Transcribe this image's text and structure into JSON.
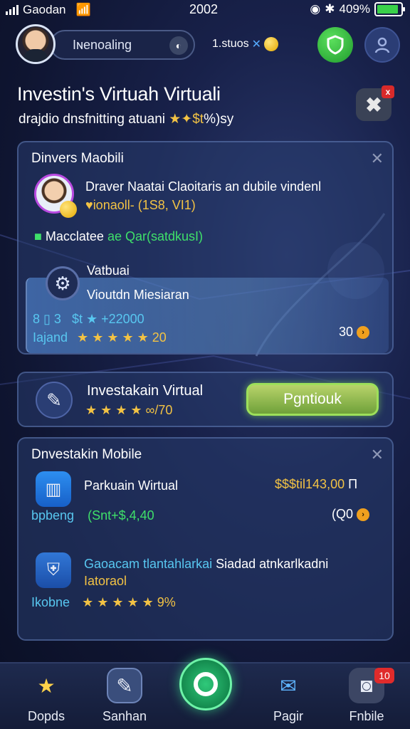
{
  "status_bar": {
    "carrier": "Gaodan",
    "time": "2002",
    "battery_text": "409%",
    "battery_level": 0.9
  },
  "header": {
    "search_text": "Iɴenoaling",
    "status_label": "1.stuos",
    "status_suffix": "✕"
  },
  "page": {
    "title": "Investin's Virtuah Virtuali",
    "subtitle_prefix": "drajdio dnsfnitting atuani",
    "subtitle_stars": "★✦$t",
    "subtitle_suffix": "%)sy",
    "close_badge": "x"
  },
  "card1": {
    "title": "Dinvers Maobili",
    "person_name": "Draver Naatai Claoitaris an dubile vindenl",
    "person_meta": "♥ionaoll- (1S8, VI1)",
    "category": "Macclatee",
    "category_extra": "ae Qar(satdkusI)",
    "virtual_label": "Vatbuai",
    "virtual_title": "Vioutdn Miesiaran",
    "stat_left": "8 ▯ 3",
    "stat_value": "$t ★ +22000",
    "rating_label": "Iajand",
    "rating_stars": "★ ★ ★ ★ ★ 20",
    "right_value": "30"
  },
  "card2": {
    "title": "Investakain Virtual",
    "stars": "★ ★ ★ ★ ∞/70",
    "button_label": "Pgntiouk"
  },
  "card3": {
    "title": "Dnvestakin Mobile",
    "item1_title": "Parkuain Wirtual",
    "item1_price": "$$$til143,00",
    "item1_suffix": "Π",
    "item1_label": "bpbeng",
    "item1_value": "(Snt+$,4,40",
    "item1_right": "(Q0",
    "item2_title": "Gaoacam tlantahlarkai",
    "item2_title_rest": "Siadad atnkarlkadni",
    "item2_sub": "Iatoraol",
    "item2_label": "Ikobne",
    "item2_stars": "★ ★ ★ ★ ★ 9%"
  },
  "nav": {
    "items": [
      {
        "label": "Dopds"
      },
      {
        "label": "Sanhan"
      },
      {
        "label": "Pagir"
      },
      {
        "label": "Fnbile",
        "badge": "10"
      }
    ]
  }
}
